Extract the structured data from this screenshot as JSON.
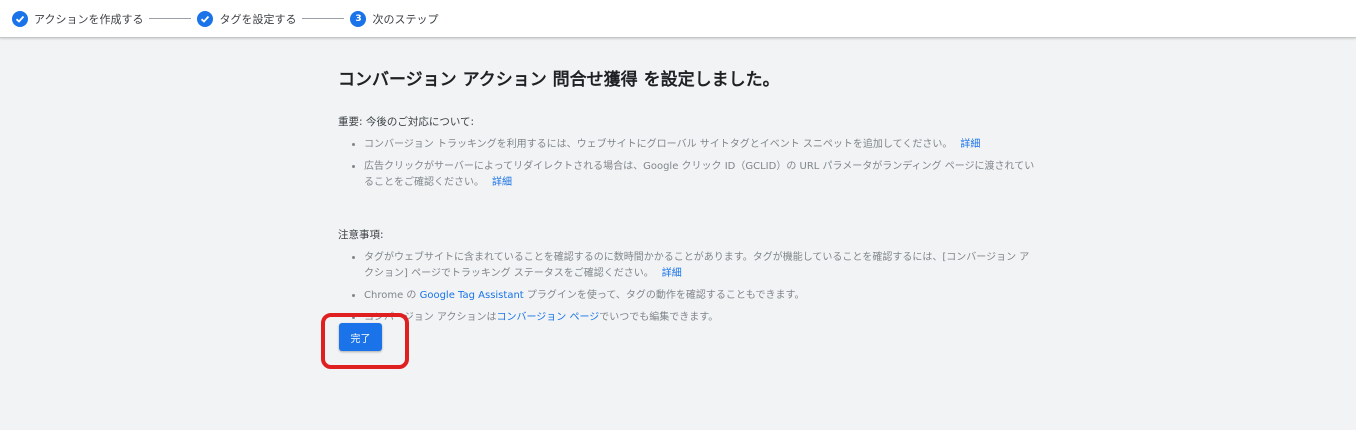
{
  "stepper": {
    "steps": [
      {
        "label": "アクションを作成する",
        "state": "done",
        "marker": "check-icon"
      },
      {
        "label": "タグを設定する",
        "state": "done",
        "marker": "check-icon"
      },
      {
        "label": "次のステップ",
        "state": "current",
        "number": "3"
      }
    ],
    "accent_color": "#1a73e8"
  },
  "main": {
    "headline": {
      "prefix": "コンバージョン アクション ",
      "name": "問合せ獲得",
      "suffix": " を設定しました。"
    },
    "important": {
      "title": "重要: 今後のご対応について:",
      "items": [
        {
          "text": "コンバージョン トラッキングを利用するには、ウェブサイトにグローバル サイトタグとイベント スニペットを追加してください。",
          "link": "詳細"
        },
        {
          "text": "広告クリックがサーバーによってリダイレクトされる場合は、Google クリック ID（GCLID）の URL パラメータがランディング ページに渡されていることをご確認ください。",
          "link": "詳細"
        }
      ]
    },
    "notes": {
      "title": "注意事項:",
      "items": [
        {
          "text": "タグがウェブサイトに含まれていることを確認するのに数時間かかることがあります。タグが機能していることを確認するには、[コンバージョン アクション] ページでトラッキング ステータスをご確認ください。",
          "link": "詳細"
        },
        {
          "before": "Chrome の ",
          "link": "Google Tag Assistant",
          "after": " プラグインを使って、タグの動作を確認することもできます。"
        },
        {
          "before": "コンバージョン アクションは",
          "link": "コンバージョン ページ",
          "after": "でいつでも編集できます。"
        }
      ]
    },
    "done_button_label": "完了",
    "highlight_color": "#e02020"
  }
}
